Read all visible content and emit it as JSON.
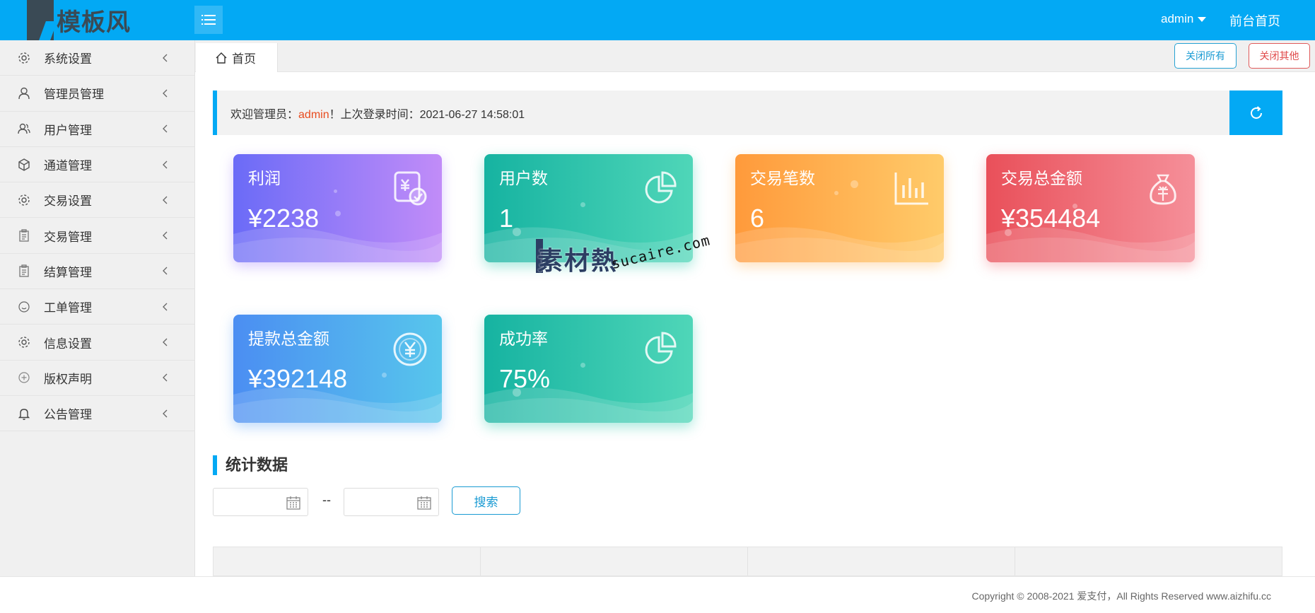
{
  "header": {
    "logo_text": "模板风",
    "user_label": "admin",
    "home_link": "前台首页"
  },
  "sidebar": {
    "items": [
      {
        "label": "系统设置",
        "icon": "gear-icon"
      },
      {
        "label": "管理员管理",
        "icon": "user-icon"
      },
      {
        "label": "用户管理",
        "icon": "users-icon"
      },
      {
        "label": "通道管理",
        "icon": "cube-icon"
      },
      {
        "label": "交易设置",
        "icon": "gear-icon"
      },
      {
        "label": "交易管理",
        "icon": "clipboard-icon"
      },
      {
        "label": "结算管理",
        "icon": "clipboard-icon"
      },
      {
        "label": "工单管理",
        "icon": "smile-icon"
      },
      {
        "label": "信息设置",
        "icon": "gear-icon"
      },
      {
        "label": "版权声明",
        "icon": "plus-circle-icon"
      },
      {
        "label": "公告管理",
        "icon": "bell-icon"
      }
    ]
  },
  "tabs": {
    "home_label": "首页",
    "close_all": "关闭所有",
    "close_other": "关闭其他"
  },
  "welcome": {
    "prefix": "欢迎管理员：",
    "username": "admin",
    "suffix": "！上次登录时间：2021-06-27 14:58:01"
  },
  "cards": {
    "profit": {
      "title": "利润",
      "value": "¥2238"
    },
    "users": {
      "title": "用户数",
      "value": "1"
    },
    "trades": {
      "title": "交易笔数",
      "value": "6"
    },
    "amount": {
      "title": "交易总金额",
      "value": "¥354484"
    },
    "withdraw": {
      "title": "提款总金额",
      "value": "¥392148"
    },
    "rate": {
      "title": "成功率",
      "value": "75%"
    }
  },
  "watermark": {
    "cn": "素材熱",
    "en": "sucaire.com"
  },
  "stats": {
    "title": "统计数据",
    "date_separator": "--",
    "search_label": "搜索",
    "start_placeholder": "",
    "end_placeholder": ""
  },
  "footer": {
    "copyright": "Copyright © 2008-2021 爱支付，All Rights Reserved www.aizhifu.cc"
  },
  "colors": {
    "primary": "#03a9f4",
    "danger": "#e04b4b",
    "highlight": "#e84b1e"
  }
}
